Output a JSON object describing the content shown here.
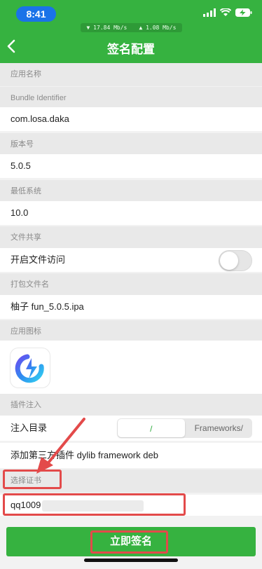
{
  "status": {
    "time": "8:41",
    "download_speed": "▼ 17.84 Mb/s",
    "upload_speed": "▲ 1.08 Mb/s"
  },
  "nav": {
    "title": "签名配置"
  },
  "fields": {
    "app_name_label": "应用名称",
    "bundle_label": "Bundle Identifier",
    "bundle_value": "com.losa.daka",
    "version_label": "版本号",
    "version_value": "5.0.5",
    "min_os_label": "最低系统",
    "min_os_value": "10.0",
    "file_share_label": "文件共享",
    "file_access_label": "开启文件访问",
    "file_access_on": false,
    "package_name_label": "打包文件名",
    "package_name_value": "柚子 fun_5.0.5.ipa",
    "icon_label": "应用图标",
    "plugin_label": "插件注入",
    "inject_dir_label": "注入目录",
    "inject_dir_options": [
      "/",
      "Frameworks/"
    ],
    "add_plugin_label": "添加第三方插件 dylib framework deb",
    "cert_label": "选择证书",
    "cert_value": "qq1009"
  },
  "actions": {
    "sign_now": "立即签名"
  },
  "colors": {
    "accent": "#36b240",
    "highlight": "#e34a4a",
    "time_pill": "#1a73e8"
  }
}
